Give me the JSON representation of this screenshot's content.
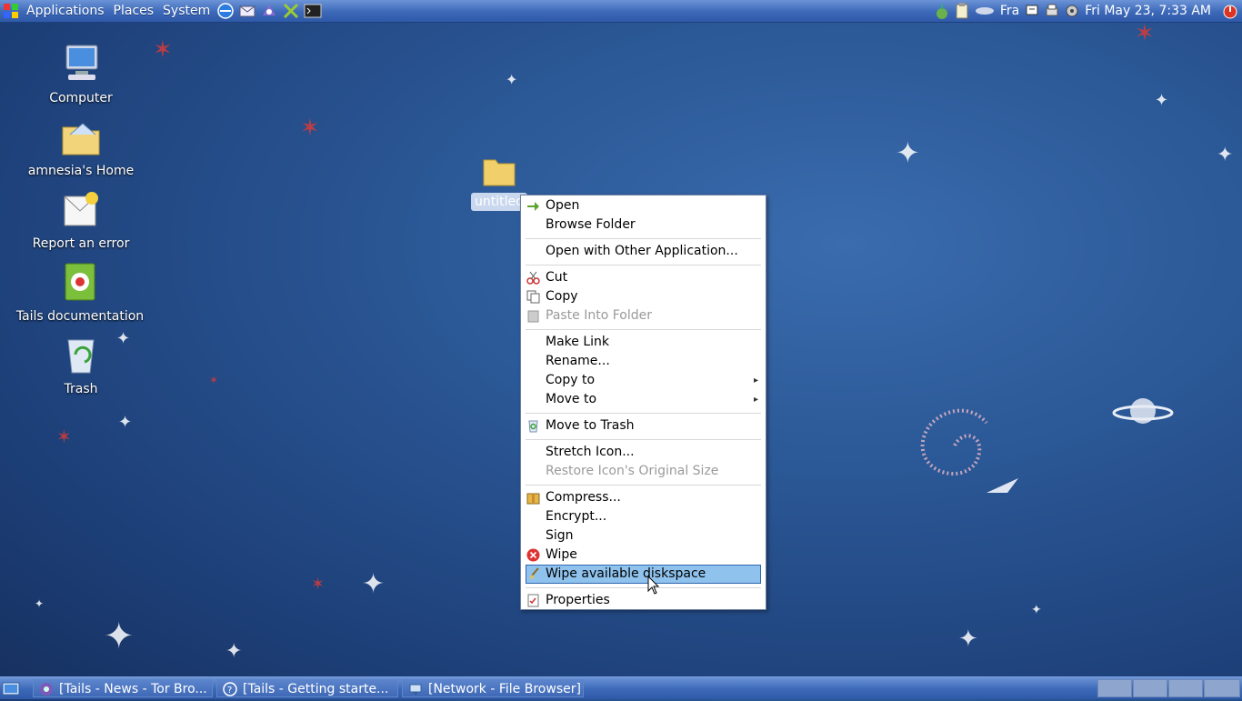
{
  "top_panel": {
    "menus": [
      "Applications",
      "Places",
      "System"
    ],
    "keyboard_layout": "Fra",
    "clock": "Fri May 23,  7:33 AM"
  },
  "desktop_icons": [
    {
      "label": "Computer",
      "icon": "computer-icon"
    },
    {
      "label": "amnesia's Home",
      "icon": "home-folder-icon"
    },
    {
      "label": "Report an error",
      "icon": "report-error-icon"
    },
    {
      "label": "Tails documentation",
      "icon": "documentation-icon"
    },
    {
      "label": "Trash",
      "icon": "trash-icon"
    }
  ],
  "selected_folder": {
    "label": "untitled"
  },
  "context_menu": {
    "items": {
      "open": "Open",
      "browse_folder": "Browse Folder",
      "open_with": "Open with Other Application...",
      "cut": "Cut",
      "copy": "Copy",
      "paste_into_folder": "Paste Into Folder",
      "make_link": "Make Link",
      "rename": "Rename...",
      "copy_to": "Copy to",
      "move_to": "Move to",
      "move_to_trash": "Move to Trash",
      "stretch_icon": "Stretch Icon...",
      "restore_icon_size": "Restore Icon's Original Size",
      "compress": "Compress...",
      "encrypt": "Encrypt...",
      "sign": "Sign",
      "wipe": "Wipe",
      "wipe_diskspace": "Wipe available diskspace",
      "properties": "Properties"
    },
    "highlighted": "Wipe available diskspace"
  },
  "taskbar": {
    "tasks": [
      "[Tails - News - Tor Bro...",
      "[Tails - Getting starte...",
      "[Network - File Browser]"
    ]
  },
  "colors": {
    "panel": "#3c68b8",
    "desktop": "#2b5896",
    "menu_highlight": "#8fc3ee"
  }
}
